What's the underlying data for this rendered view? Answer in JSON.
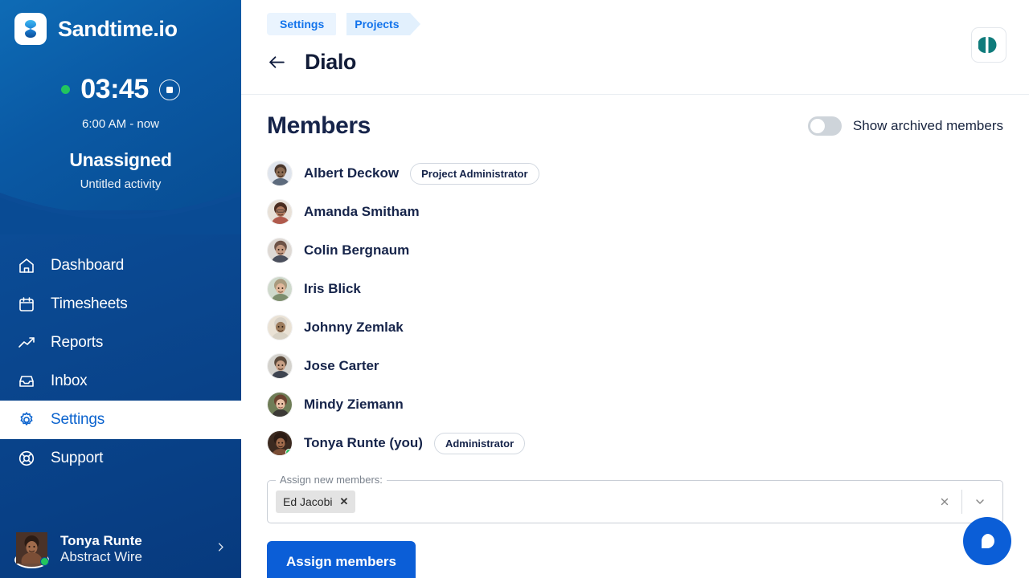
{
  "sidebar": {
    "brand": {
      "name": "Sandtime.io",
      "logo_icon": "hourglass-logo-icon"
    },
    "timer": {
      "value": "03:45",
      "range": "6:00 AM - now",
      "status_color": "#22c55e",
      "stop_label": "stop-timer"
    },
    "task": {
      "title": "Unassigned",
      "subtitle": "Untitled activity"
    },
    "nav_items": [
      {
        "label": "Dashboard",
        "icon": "home-icon",
        "active": false
      },
      {
        "label": "Timesheets",
        "icon": "calendar-icon",
        "active": false
      },
      {
        "label": "Reports",
        "icon": "trending-up-icon",
        "active": false
      },
      {
        "label": "Inbox",
        "icon": "inbox-icon",
        "active": false
      },
      {
        "label": "Settings",
        "icon": "gear-icon",
        "active": true
      },
      {
        "label": "Support",
        "icon": "lifebuoy-icon",
        "active": false
      }
    ],
    "profile": {
      "name": "Tonya Runte",
      "org": "Abstract Wire",
      "chevron_icon": "chevron-right-icon"
    }
  },
  "header": {
    "breadcrumb": [
      {
        "label": "Settings"
      },
      {
        "label": "Projects"
      }
    ],
    "back_icon": "arrow-left-icon",
    "title": "Dialo",
    "corner_logo_icon": "project-logo-icon",
    "corner_logo_color": "#0f7b7b"
  },
  "members_section": {
    "title": "Members",
    "archived_toggle": {
      "label": "Show archived members",
      "on": false
    },
    "members": [
      {
        "name": "Albert Deckow",
        "badge": "Project Administrator",
        "online": false,
        "avatar_color": "#8a6a52"
      },
      {
        "name": "Amanda Smitham",
        "badge": "",
        "online": false,
        "avatar_color": "#b07a5e"
      },
      {
        "name": "Colin Bergnaum",
        "badge": "",
        "online": false,
        "avatar_color": "#7e6257"
      },
      {
        "name": "Iris Blick",
        "badge": "",
        "online": false,
        "avatar_color": "#8e9b7a"
      },
      {
        "name": "Johnny Zemlak",
        "badge": "",
        "online": false,
        "avatar_color": "#9c7b5c"
      },
      {
        "name": "Jose Carter",
        "badge": "",
        "online": false,
        "avatar_color": "#6f6258"
      },
      {
        "name": "Mindy Ziemann",
        "badge": "",
        "online": false,
        "avatar_color": "#6f7d57"
      },
      {
        "name": "Tonya Runte (you)",
        "badge": "Administrator",
        "online": true,
        "avatar_color": "#6b4a3a"
      }
    ]
  },
  "assign": {
    "legend": "Assign new members:",
    "chips": [
      {
        "label": "Ed Jacobi",
        "remove_icon": "chip-remove-icon"
      }
    ],
    "clear_icon": "clear-icon",
    "caret_icon": "chevron-down-icon",
    "button_label": "Assign members"
  },
  "chat": {
    "icon": "chat-bubble-icon",
    "color": "#0b5ed7"
  },
  "theme": {
    "accent_blue": "#0b5ed7",
    "sidebar_blue": "#0b4c96",
    "breadcrumb_bg": "#eaf4fe",
    "title_navy": "#16244a"
  }
}
